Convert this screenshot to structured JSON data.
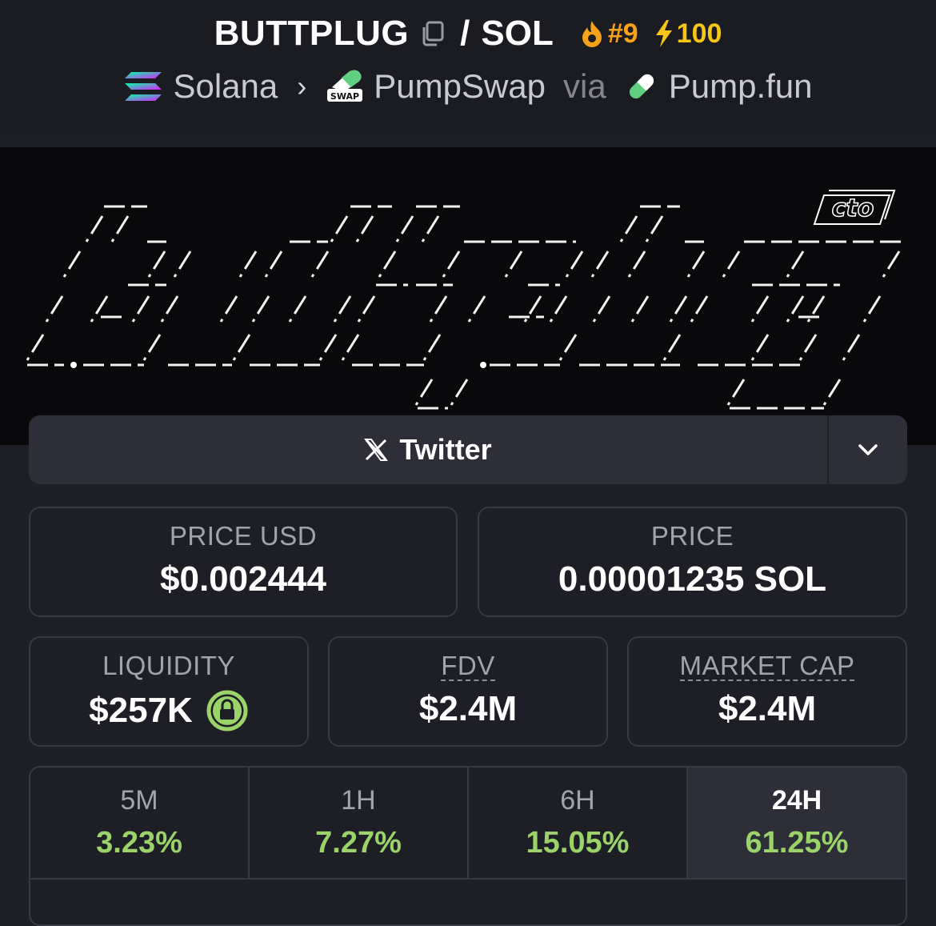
{
  "header": {
    "symbol": "BUTTPLUG",
    "slash": "/",
    "quote": "SOL",
    "rank": "#9",
    "boosts": "100",
    "chain": "Solana",
    "dex": "PumpSwap",
    "via": "via",
    "launchpad": "Pump.fun",
    "icons": [
      "copy-icon",
      "fire-icon",
      "lightning-icon",
      "solana-logo",
      "pumpswap-logo",
      "pumpfun-pill-logo"
    ]
  },
  "banner": {
    "art_text": "buttplug",
    "badge_text": "cto"
  },
  "links": {
    "twitter_label": "Twitter"
  },
  "prices": {
    "price_usd_label": "PRICE USD",
    "price_usd": "$0.002444",
    "price_label": "PRICE",
    "price_native": "0.00001235 SOL"
  },
  "stats": {
    "liquidity_label": "LIQUIDITY",
    "liquidity": "$257K",
    "fdv_label": "FDV",
    "fdv": "$2.4M",
    "mcap_label": "MARKET CAP",
    "mcap": "$2.4M"
  },
  "changes": [
    {
      "period": "5M",
      "value": "3.23%"
    },
    {
      "period": "1H",
      "value": "7.27%"
    },
    {
      "period": "6H",
      "value": "15.05%"
    },
    {
      "period": "24H",
      "value": "61.25%"
    }
  ],
  "colors": {
    "positive": "#9bd36a",
    "rank": "#f7a21b",
    "boost": "#f5c518",
    "lock": "#9bd36a"
  }
}
